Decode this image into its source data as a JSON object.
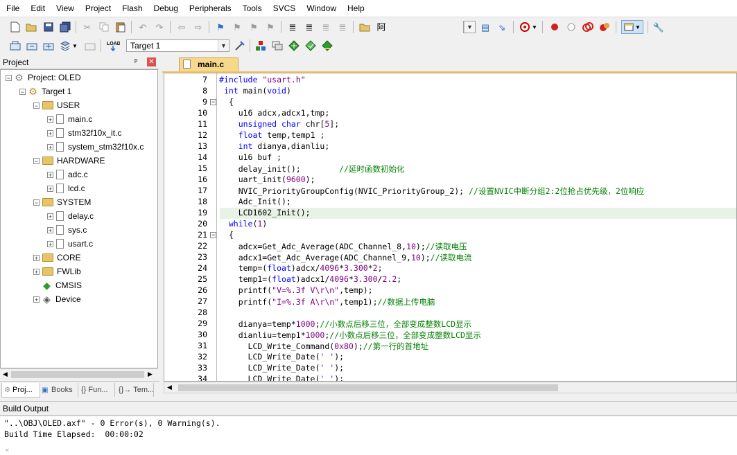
{
  "menu": [
    "File",
    "Edit",
    "View",
    "Project",
    "Flash",
    "Debug",
    "Peripherals",
    "Tools",
    "SVCS",
    "Window",
    "Help"
  ],
  "toolbar": {
    "find_text": "阿",
    "target": "Target 1"
  },
  "project_panel": {
    "title": "Project",
    "pin": "ᵖ",
    "root": "Project: OLED",
    "target": "Target 1",
    "groups": [
      {
        "name": "USER",
        "files": [
          "main.c",
          "stm32f10x_it.c",
          "system_stm32f10x.c"
        ]
      },
      {
        "name": "HARDWARE",
        "files": [
          "adc.c",
          "lcd.c"
        ]
      },
      {
        "name": "SYSTEM",
        "files": [
          "delay.c",
          "sys.c",
          "usart.c"
        ]
      },
      {
        "name": "CORE"
      },
      {
        "name": "FWLib"
      },
      {
        "name": "CMSIS"
      },
      {
        "name": "Device"
      }
    ],
    "tabs": [
      "Proj...",
      "Books",
      "{} Fun...",
      "{}→ Tem..."
    ]
  },
  "editor": {
    "tab": "main.c",
    "lines": [
      {
        "n": "7"
      },
      {
        "n": "8"
      },
      {
        "n": "9"
      },
      {
        "n": "10"
      },
      {
        "n": "11"
      },
      {
        "n": "12"
      },
      {
        "n": "13"
      },
      {
        "n": "14"
      },
      {
        "n": "15"
      },
      {
        "n": "16"
      },
      {
        "n": "17"
      },
      {
        "n": "18"
      },
      {
        "n": "19"
      },
      {
        "n": "20"
      },
      {
        "n": "21"
      },
      {
        "n": "22"
      },
      {
        "n": "23"
      },
      {
        "n": "24"
      },
      {
        "n": "25"
      },
      {
        "n": "26"
      },
      {
        "n": "27"
      },
      {
        "n": "28"
      },
      {
        "n": "29"
      },
      {
        "n": "30"
      },
      {
        "n": "31"
      },
      {
        "n": "32"
      },
      {
        "n": "33"
      },
      {
        "n": "34"
      }
    ],
    "code": [
      "#include \"usart.h\"",
      " int main(void)",
      "  {",
      "    u16 adcx,adcx1,tmp;",
      "    unsigned char chr[5];",
      "    float temp,temp1 ;",
      "    int dianya,dianliu;",
      "    u16 buf ;",
      "    delay_init();        //延时函数初始化",
      "    uart_init(9600);",
      "    NVIC_PriorityGroupConfig(NVIC_PriorityGroup_2); //设置NVIC中断分组2:2位抢占优先级，2位响应",
      "    Adc_Init();",
      "    LCD1602_Init();",
      "  while(1)",
      "  {",
      "    adcx=Get_Adc_Average(ADC_Channel_8,10);//读取电压",
      "    adcx1=Get_Adc_Average(ADC_Channel_9,10);//读取电流",
      "    temp=(float)adcx/4096*3.300*2;",
      "    temp1=(float)adcx1/4096*3.300/2.2;",
      "    printf(\"V=%.3f V\\r\\n\",temp);",
      "    printf(\"I=%.3f A\\r\\n\",temp1);//数据上传电脑",
      "",
      "    dianya=temp*1000;//小数点后移三位，全部变成整数LCD显示",
      "    dianliu=temp1*1000;//小数点后移三位，全部变成整数LCD显示",
      "      LCD_Write_Command(0x80);//第一行的首地址",
      "      LCD_Write_Date(' ');",
      "      LCD_Write_Date(' ');",
      "      LCD_Write_Date(' ');"
    ]
  },
  "build_output": {
    "title": "Build Output",
    "lines": [
      "\"..\\OBJ\\OLED.axf\" - 0 Error(s), 0 Warning(s).",
      "Build Time Elapsed:  00:00:02"
    ]
  }
}
